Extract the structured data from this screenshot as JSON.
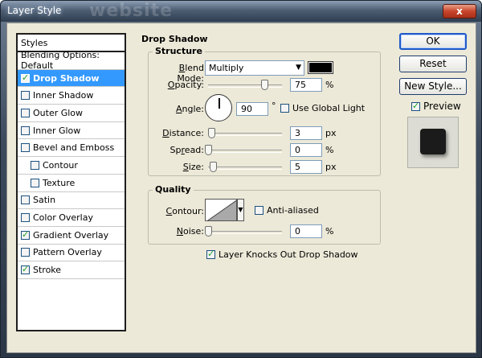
{
  "window": {
    "title": "Layer Style",
    "ghost_text": "website",
    "close_glyph": "x"
  },
  "styles_panel": {
    "header": "Styles",
    "blending": "Blending Options: Default",
    "items": [
      {
        "label": "Drop Shadow",
        "checked": true,
        "selected": true,
        "indent": false
      },
      {
        "label": "Inner Shadow",
        "checked": false,
        "selected": false,
        "indent": false
      },
      {
        "label": "Outer Glow",
        "checked": false,
        "selected": false,
        "indent": false
      },
      {
        "label": "Inner Glow",
        "checked": false,
        "selected": false,
        "indent": false
      },
      {
        "label": "Bevel and Emboss",
        "checked": false,
        "selected": false,
        "indent": false
      },
      {
        "label": "Contour",
        "checked": false,
        "selected": false,
        "indent": true
      },
      {
        "label": "Texture",
        "checked": false,
        "selected": false,
        "indent": true
      },
      {
        "label": "Satin",
        "checked": false,
        "selected": false,
        "indent": false
      },
      {
        "label": "Color Overlay",
        "checked": false,
        "selected": false,
        "indent": false
      },
      {
        "label": "Gradient Overlay",
        "checked": true,
        "selected": false,
        "indent": false
      },
      {
        "label": "Pattern Overlay",
        "checked": false,
        "selected": false,
        "indent": false
      },
      {
        "label": "Stroke",
        "checked": true,
        "selected": false,
        "indent": false
      }
    ]
  },
  "buttons": {
    "ok": "OK",
    "reset": "Reset",
    "new_style": "New Style...",
    "preview": "Preview"
  },
  "preview_checked": true,
  "drop_shadow": {
    "title": "Drop Shadow",
    "structure": {
      "label": "Structure",
      "blend_mode_label": "Blend Mode:",
      "blend_mode_value": "Multiply",
      "shadow_color": "#000000",
      "opacity_label": "Opacity:",
      "opacity_value": "75",
      "opacity_unit": "%",
      "angle_label": "Angle:",
      "angle_value": "90",
      "angle_unit": "°",
      "global_light_label": "Use Global Light",
      "global_light_checked": false,
      "distance_label": "Distance:",
      "distance_value": "3",
      "distance_unit": "px",
      "spread_label": "Spread:",
      "spread_value": "0",
      "spread_unit": "%",
      "size_label": "Size:",
      "size_value": "5",
      "size_unit": "px"
    },
    "quality": {
      "label": "Quality",
      "contour_label": "Contour:",
      "anti_aliased_label": "Anti-aliased",
      "anti_aliased_checked": false,
      "noise_label": "Noise:",
      "noise_value": "0",
      "noise_unit": "%"
    },
    "knockout_label": "Layer Knocks Out Drop Shadow",
    "knockout_checked": true
  }
}
